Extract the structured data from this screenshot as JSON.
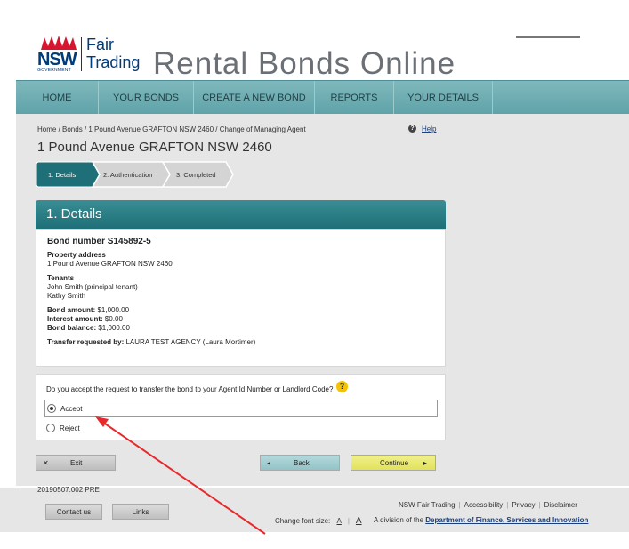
{
  "header": {
    "logo_nsw": "NSW",
    "logo_gov": "GOVERNMENT",
    "logo_fair": "Fair",
    "logo_trading": "Trading",
    "site_title": "Rental Bonds Online"
  },
  "nav": {
    "items": [
      {
        "label": "HOME"
      },
      {
        "label": "YOUR BONDS"
      },
      {
        "label": "CREATE A NEW BOND"
      },
      {
        "label": "REPORTS"
      },
      {
        "label": "YOUR DETAILS"
      }
    ]
  },
  "breadcrumb": "Home / Bonds / 1 Pound Avenue GRAFTON NSW 2460 / Change of Managing Agent",
  "help_label": "Help",
  "page_heading": "1 Pound Avenue GRAFTON NSW 2460",
  "steps": [
    {
      "label": "1. Details",
      "active": true
    },
    {
      "label": "2. Authentication",
      "active": false
    },
    {
      "label": "3. Completed",
      "active": false
    }
  ],
  "panel": {
    "title": "1. Details",
    "bond_number": "Bond number S145892-5",
    "property_label": "Property address",
    "property_value": "1 Pound Avenue GRAFTON NSW 2460",
    "tenants_label": "Tenants",
    "tenant_1": "John Smith (principal tenant)",
    "tenant_2": "Kathy Smith",
    "bond_amount_label": "Bond amount:",
    "bond_amount_value": "$1,000.00",
    "interest_label": "Interest amount:",
    "interest_value": "$0.00",
    "balance_label": "Bond balance:",
    "balance_value": "$1,000.00",
    "transfer_label": "Transfer requested by:",
    "transfer_value": "LAURA TEST AGENCY (Laura Mortimer)"
  },
  "question": {
    "text": "Do you accept the request to transfer the bond to your Agent Id Number or Landlord Code?",
    "accept_label": "Accept",
    "reject_label": "Reject",
    "selected": "Accept"
  },
  "buttons": {
    "exit": "Exit",
    "back": "Back",
    "continue": "Continue"
  },
  "version": "20190507.002 PRE",
  "footer": {
    "contact": "Contact us",
    "links": "Links",
    "link_items": [
      "NSW Fair Trading",
      "Accessibility",
      "Privacy",
      "Disclaimer"
    ],
    "font_size_label": "Change font size:",
    "font_small": "A",
    "font_large": "A",
    "division_prefix": "A division of the",
    "division_link": "Department of Finance, Services and Innovation"
  },
  "colors": {
    "nav": "#6aacb1",
    "panel_header": "#2a7d85",
    "step_active": "#1e6f77",
    "continue": "#e8e870",
    "help_icon": "#f5c400",
    "arrow": "#e8282b"
  }
}
